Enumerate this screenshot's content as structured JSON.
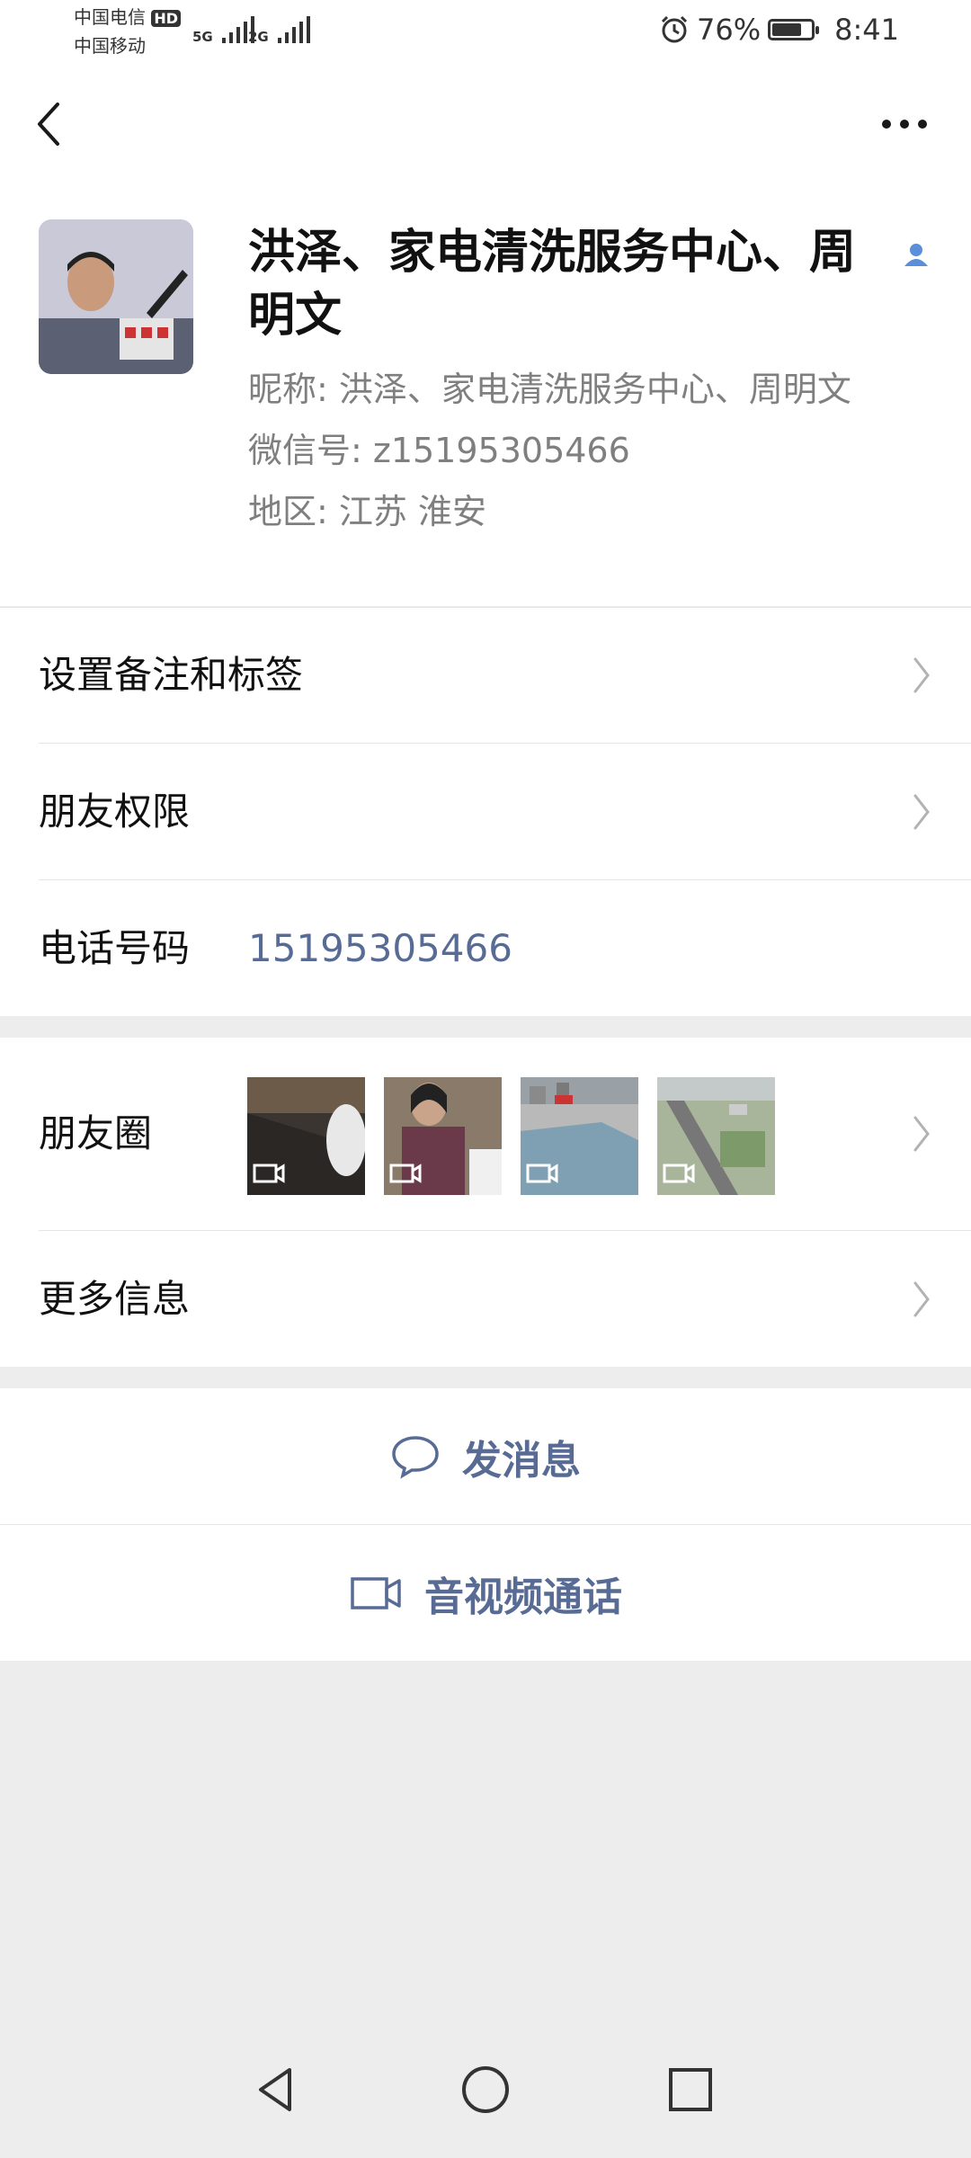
{
  "status_bar": {
    "carrier1": "中国电信",
    "carrier1_badge": "HD",
    "carrier2": "中国移动",
    "sig1": "5G",
    "sig2": "2G",
    "battery_percent": "76%",
    "battery_level": 0.76,
    "time": "8:41"
  },
  "profile": {
    "name": "洪泽、家电清洗服务中心、周明文",
    "nickname": "昵称: 洪泽、家电清洗服务中心、周明文",
    "wechat_id": "微信号: z15195305466",
    "region": "地区: 江苏  淮安"
  },
  "rows": {
    "remark": "设置备注和标签",
    "permission": "朋友权限",
    "phone_label": "电话号码",
    "phone_value": "15195305466",
    "moments": "朋友圈",
    "more": "更多信息"
  },
  "actions": {
    "message": "发消息",
    "call": "音视频通话"
  },
  "colors": {
    "link": "#576b95",
    "background": "#ededed"
  }
}
